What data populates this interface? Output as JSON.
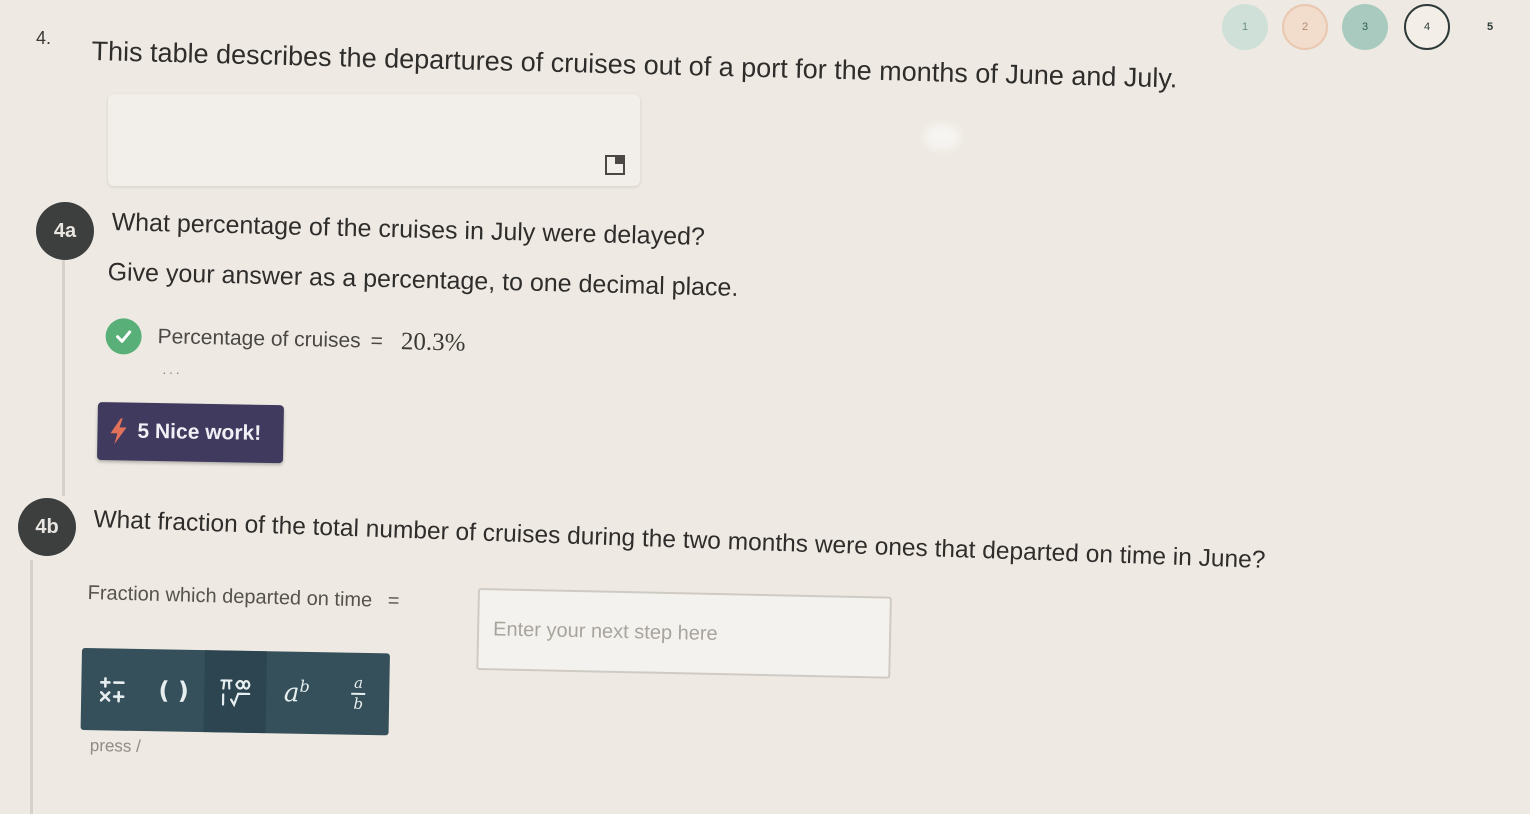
{
  "progress": {
    "steps": [
      "1",
      "2",
      "3",
      "4",
      "5"
    ],
    "current_step": "4"
  },
  "question": {
    "number": "4.",
    "intro": "This table describes the departures of cruises out of a port for the months of June and July."
  },
  "part_4a": {
    "badge": "4a",
    "prompt": "What percentage of the cruises in July were delayed?",
    "instruction": "Give your answer as a percentage, to one decimal place.",
    "answer_label": "Percentage of cruises",
    "answer_eq": "=",
    "answer_value": "20.3%",
    "status": "correct",
    "feedback": {
      "text": "5 Nice work!",
      "icon": "lightning-icon"
    }
  },
  "part_4b": {
    "badge": "4b",
    "prompt": "What fraction of the total number of cruises during the two months were ones that departed on time in June?",
    "answer_label": "Fraction which departed on time",
    "answer_eq": "=",
    "input_placeholder": "Enter your next step here",
    "input_value": ""
  },
  "math_toolbar": {
    "buttons": [
      {
        "name": "operators",
        "icon": "plus-minus-times-icon"
      },
      {
        "name": "parentheses",
        "icon": "parentheses-icon",
        "label": "( )"
      },
      {
        "name": "symbols",
        "icon": "pi-infinity-root-icon"
      },
      {
        "name": "exponent",
        "icon": "exponent-icon",
        "label": "a",
        "sup": "b"
      },
      {
        "name": "fraction",
        "icon": "fraction-icon",
        "num": "a",
        "den": "b"
      }
    ]
  },
  "press_hint": "press /",
  "colors": {
    "background": "#eeeae3",
    "badge": "#3d3f3e",
    "correct_green": "#58b078",
    "feedback_purple": "#3f3a5e",
    "toolbar": "#35505a"
  }
}
